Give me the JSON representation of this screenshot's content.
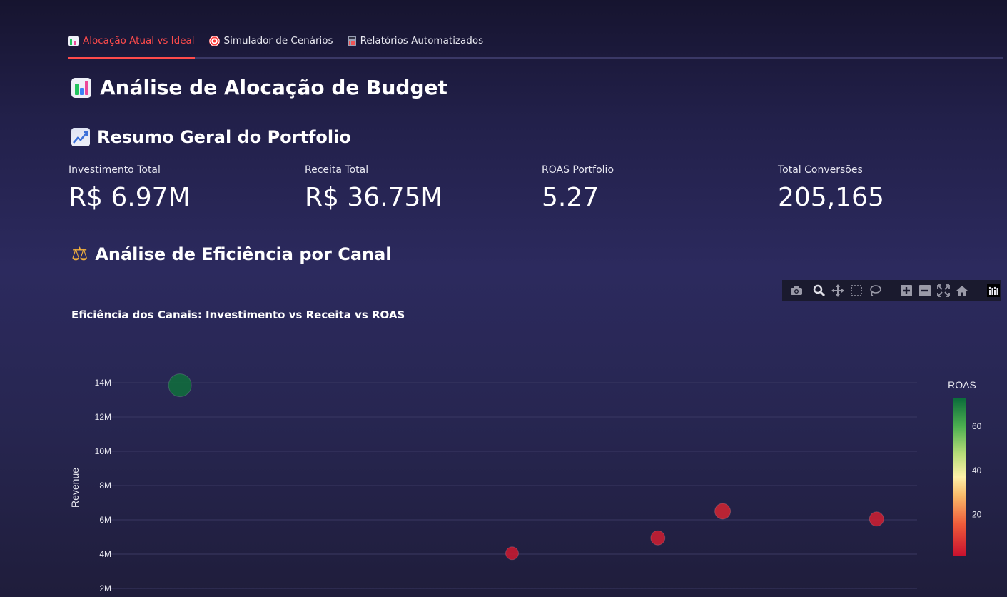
{
  "tabs": [
    {
      "label": "Alocação Atual vs Ideal",
      "icon": "bar-chart-icon",
      "active": true
    },
    {
      "label": "Simulador de Cenários",
      "icon": "target-icon",
      "active": false
    },
    {
      "label": "Relatórios Automatizados",
      "icon": "calculator-icon",
      "active": false
    }
  ],
  "page_title": "Análise de Alocação de Budget",
  "summary": {
    "heading": "Resumo Geral do Portfolio",
    "metrics": [
      {
        "label": "Investimento Total",
        "value": "R$ 6.97M"
      },
      {
        "label": "Receita Total",
        "value": "R$ 36.75M"
      },
      {
        "label": "ROAS Portfolio",
        "value": "5.27"
      },
      {
        "label": "Total Conversões",
        "value": "205,165"
      }
    ]
  },
  "efficiency": {
    "heading": "Análise de Eficiência por Canal"
  },
  "modebar": [
    "camera-icon",
    "zoom-icon",
    "pan-icon",
    "box-select-icon",
    "lasso-icon",
    "zoom-in-icon",
    "zoom-out-icon",
    "autoscale-icon",
    "home-icon",
    "plotly-logo-icon"
  ],
  "chart_data": {
    "type": "scatter",
    "title": "Eficiência dos Canais: Investimento vs Receita vs ROAS",
    "ylabel": "Revenue",
    "xlabel": "",
    "y_ticks": [
      "2M",
      "4M",
      "6M",
      "8M",
      "10M",
      "12M",
      "14M"
    ],
    "ylim": [
      1800000,
      14600000
    ],
    "points": [
      {
        "x_rel": 0.09,
        "revenue": 13850000,
        "roas": 72,
        "size": 16
      },
      {
        "x_rel": 0.5,
        "revenue": 4050000,
        "roas": 3,
        "size": 9
      },
      {
        "x_rel": 0.68,
        "revenue": 4950000,
        "roas": 4,
        "size": 10
      },
      {
        "x_rel": 0.76,
        "revenue": 6500000,
        "roas": 5,
        "size": 11
      },
      {
        "x_rel": 0.95,
        "revenue": 6050000,
        "roas": 4,
        "size": 10
      }
    ],
    "colorbar": {
      "title": "ROAS",
      "ticks": [
        20,
        40,
        60
      ],
      "range": [
        1,
        73
      ]
    },
    "colors": {
      "low": "#c8102e",
      "mid": "#fbe89c",
      "high": "#0a6b3a"
    }
  }
}
